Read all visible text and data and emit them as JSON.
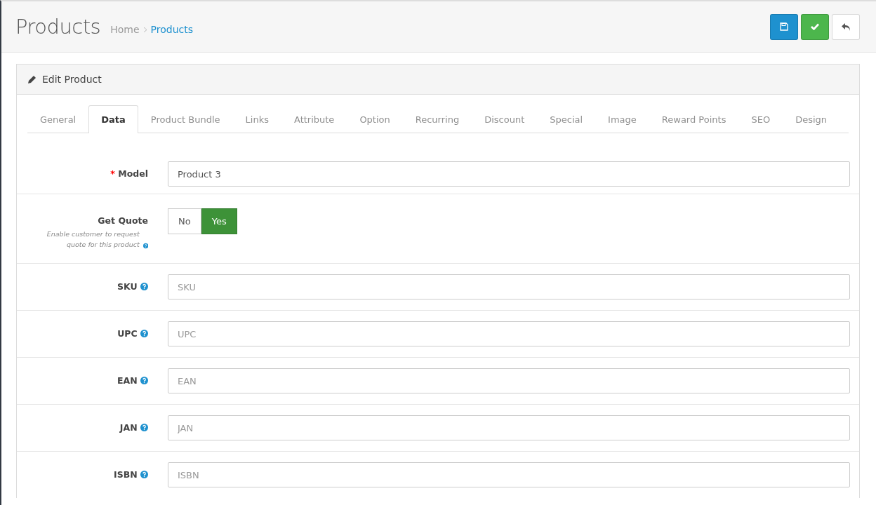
{
  "page": {
    "title": "Products",
    "breadcrumb": [
      {
        "label": "Home",
        "current": false
      },
      {
        "label": "Products",
        "current": true
      }
    ]
  },
  "actions": [
    {
      "kind": "save",
      "color": "#1e91cf"
    },
    {
      "kind": "apply",
      "color": "#4cb64c"
    },
    {
      "kind": "back",
      "color": "#ffffff"
    }
  ],
  "panel": {
    "title": "Edit Product"
  },
  "tabs": [
    {
      "label": "General",
      "selected": false
    },
    {
      "label": "Data",
      "selected": true
    },
    {
      "label": "Product Bundle",
      "selected": false
    },
    {
      "label": "Links",
      "selected": false
    },
    {
      "label": "Attribute",
      "selected": false
    },
    {
      "label": "Option",
      "selected": false
    },
    {
      "label": "Recurring",
      "selected": false
    },
    {
      "label": "Discount",
      "selected": false
    },
    {
      "label": "Special",
      "selected": false
    },
    {
      "label": "Image",
      "selected": false
    },
    {
      "label": "Reward Points",
      "selected": false
    },
    {
      "label": "SEO",
      "selected": false
    },
    {
      "label": "Design",
      "selected": false
    }
  ],
  "model": {
    "label": "Model",
    "required_mark": "*",
    "value": "Product 3"
  },
  "get_quote": {
    "label": "Get Quote",
    "help": "Enable customer to request quote for this product",
    "options": [
      {
        "label": "No",
        "selected": false
      },
      {
        "label": "Yes",
        "selected": true
      }
    ]
  },
  "fields": [
    {
      "label": "SKU",
      "placeholder": "SKU"
    },
    {
      "label": "UPC",
      "placeholder": "UPC"
    },
    {
      "label": "EAN",
      "placeholder": "EAN"
    },
    {
      "label": "JAN",
      "placeholder": "JAN"
    },
    {
      "label": "ISBN",
      "placeholder": "ISBN"
    }
  ]
}
